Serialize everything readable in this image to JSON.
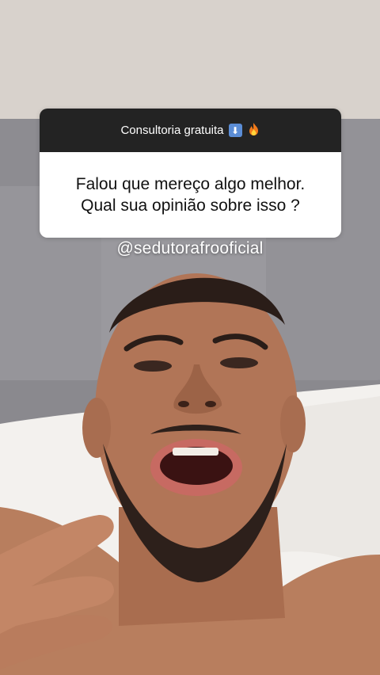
{
  "question_sticker": {
    "header_text": "Consultoria gratuita",
    "header_emojis": [
      "down-arrow-emoji",
      "fire-emoji"
    ],
    "header_color": "#232323",
    "question_lines": [
      "Falou que mereço algo melhor.",
      "Qual sua opinião sobre isso ?"
    ]
  },
  "handle": "@sedutorafrooficial"
}
